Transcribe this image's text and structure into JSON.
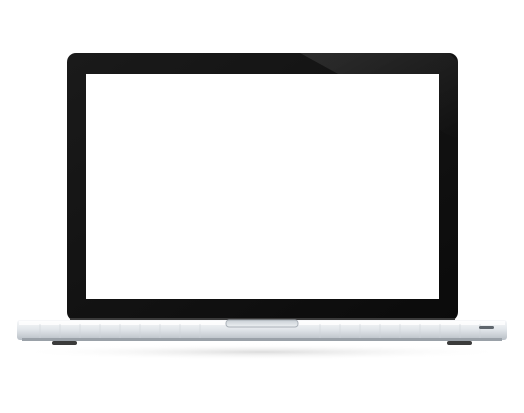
{
  "illustration": {
    "subject": "laptop-mockup",
    "screen_state": "blank",
    "colors": {
      "background": "#ffffff",
      "bezel": "#111111",
      "bezel_edge": "#2a2a2a",
      "screen": "#ffffff",
      "base_light": "#f2f4f6",
      "base_mid": "#d9dee3",
      "base_dark": "#a9b0b7",
      "hinge_line": "#8a8f94",
      "shadow": "#e9e9e9"
    }
  }
}
